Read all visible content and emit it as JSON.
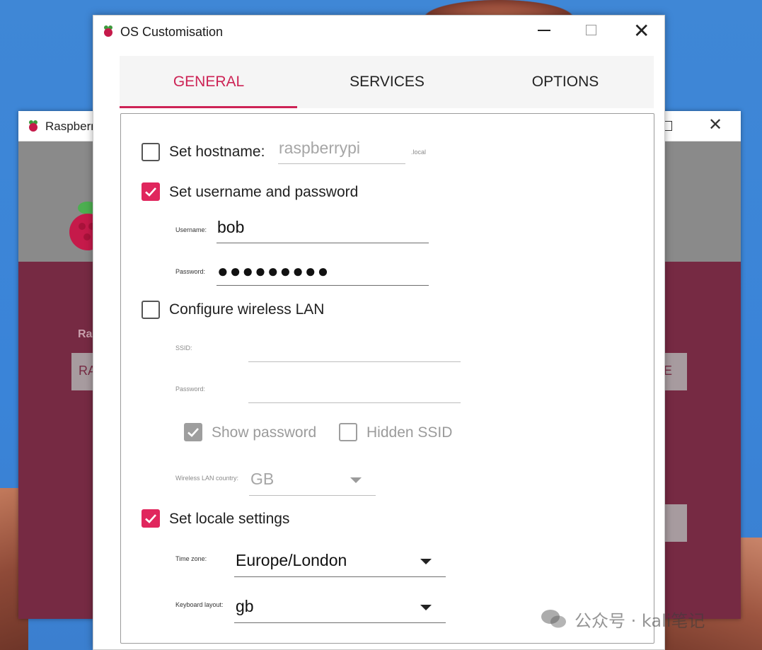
{
  "background_window": {
    "title": "Raspberr",
    "label_partial": "Ra",
    "button_partial_left": "RA",
    "button_partial_right": "E"
  },
  "dialog": {
    "title": "OS Customisation",
    "icon": "raspberry-pi-icon"
  },
  "tabs": [
    {
      "label": "GENERAL",
      "active": true
    },
    {
      "label": "SERVICES",
      "active": false
    },
    {
      "label": "OPTIONS",
      "active": false
    }
  ],
  "general": {
    "hostname": {
      "label": "Set hostname:",
      "checked": false,
      "placeholder": "raspberrypi",
      "suffix": ".local"
    },
    "user": {
      "label": "Set username and password",
      "checked": true,
      "username_label": "Username:",
      "username_value": "bob",
      "password_label": "Password:",
      "password_value": "●●●●●●●●●"
    },
    "wlan": {
      "label": "Configure wireless LAN",
      "checked": false,
      "ssid_label": "SSID:",
      "ssid_value": "",
      "password_label": "Password:",
      "password_value": "",
      "show_password_label": "Show password",
      "show_password_checked": true,
      "hidden_ssid_label": "Hidden SSID",
      "hidden_ssid_checked": false,
      "country_label": "Wireless LAN country:",
      "country_value": "GB"
    },
    "locale": {
      "label": "Set locale settings",
      "checked": true,
      "timezone_label": "Time zone:",
      "timezone_value": "Europe/London",
      "keyboard_label": "Keyboard layout:",
      "keyboard_value": "gb"
    }
  },
  "watermark": "公众号 · kali笔记",
  "colors": {
    "accent": "#cd2355",
    "checkbox_on": "#e0265d",
    "bg_window": "#762a43",
    "desktop": "#3a84d8"
  }
}
